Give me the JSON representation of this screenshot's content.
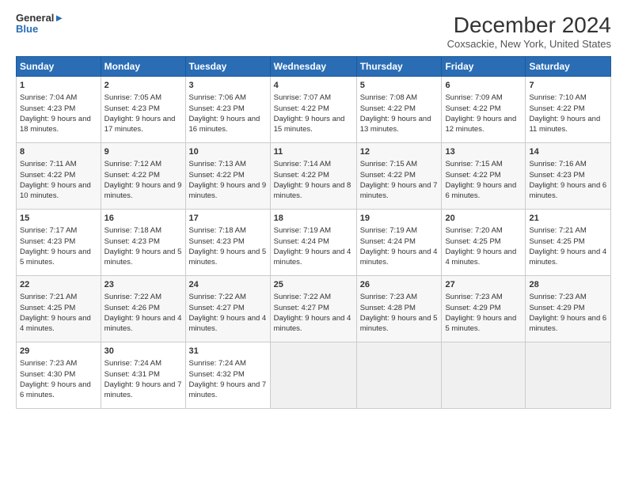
{
  "logo": {
    "line1": "General",
    "line2": "Blue"
  },
  "title": "December 2024",
  "location": "Coxsackie, New York, United States",
  "days_header": [
    "Sunday",
    "Monday",
    "Tuesday",
    "Wednesday",
    "Thursday",
    "Friday",
    "Saturday"
  ],
  "weeks": [
    [
      {
        "day": "1",
        "sunrise": "Sunrise: 7:04 AM",
        "sunset": "Sunset: 4:23 PM",
        "daylight": "Daylight: 9 hours and 18 minutes."
      },
      {
        "day": "2",
        "sunrise": "Sunrise: 7:05 AM",
        "sunset": "Sunset: 4:23 PM",
        "daylight": "Daylight: 9 hours and 17 minutes."
      },
      {
        "day": "3",
        "sunrise": "Sunrise: 7:06 AM",
        "sunset": "Sunset: 4:23 PM",
        "daylight": "Daylight: 9 hours and 16 minutes."
      },
      {
        "day": "4",
        "sunrise": "Sunrise: 7:07 AM",
        "sunset": "Sunset: 4:22 PM",
        "daylight": "Daylight: 9 hours and 15 minutes."
      },
      {
        "day": "5",
        "sunrise": "Sunrise: 7:08 AM",
        "sunset": "Sunset: 4:22 PM",
        "daylight": "Daylight: 9 hours and 13 minutes."
      },
      {
        "day": "6",
        "sunrise": "Sunrise: 7:09 AM",
        "sunset": "Sunset: 4:22 PM",
        "daylight": "Daylight: 9 hours and 12 minutes."
      },
      {
        "day": "7",
        "sunrise": "Sunrise: 7:10 AM",
        "sunset": "Sunset: 4:22 PM",
        "daylight": "Daylight: 9 hours and 11 minutes."
      }
    ],
    [
      {
        "day": "8",
        "sunrise": "Sunrise: 7:11 AM",
        "sunset": "Sunset: 4:22 PM",
        "daylight": "Daylight: 9 hours and 10 minutes."
      },
      {
        "day": "9",
        "sunrise": "Sunrise: 7:12 AM",
        "sunset": "Sunset: 4:22 PM",
        "daylight": "Daylight: 9 hours and 9 minutes."
      },
      {
        "day": "10",
        "sunrise": "Sunrise: 7:13 AM",
        "sunset": "Sunset: 4:22 PM",
        "daylight": "Daylight: 9 hours and 9 minutes."
      },
      {
        "day": "11",
        "sunrise": "Sunrise: 7:14 AM",
        "sunset": "Sunset: 4:22 PM",
        "daylight": "Daylight: 9 hours and 8 minutes."
      },
      {
        "day": "12",
        "sunrise": "Sunrise: 7:15 AM",
        "sunset": "Sunset: 4:22 PM",
        "daylight": "Daylight: 9 hours and 7 minutes."
      },
      {
        "day": "13",
        "sunrise": "Sunrise: 7:15 AM",
        "sunset": "Sunset: 4:22 PM",
        "daylight": "Daylight: 9 hours and 6 minutes."
      },
      {
        "day": "14",
        "sunrise": "Sunrise: 7:16 AM",
        "sunset": "Sunset: 4:23 PM",
        "daylight": "Daylight: 9 hours and 6 minutes."
      }
    ],
    [
      {
        "day": "15",
        "sunrise": "Sunrise: 7:17 AM",
        "sunset": "Sunset: 4:23 PM",
        "daylight": "Daylight: 9 hours and 5 minutes."
      },
      {
        "day": "16",
        "sunrise": "Sunrise: 7:18 AM",
        "sunset": "Sunset: 4:23 PM",
        "daylight": "Daylight: 9 hours and 5 minutes."
      },
      {
        "day": "17",
        "sunrise": "Sunrise: 7:18 AM",
        "sunset": "Sunset: 4:23 PM",
        "daylight": "Daylight: 9 hours and 5 minutes."
      },
      {
        "day": "18",
        "sunrise": "Sunrise: 7:19 AM",
        "sunset": "Sunset: 4:24 PM",
        "daylight": "Daylight: 9 hours and 4 minutes."
      },
      {
        "day": "19",
        "sunrise": "Sunrise: 7:19 AM",
        "sunset": "Sunset: 4:24 PM",
        "daylight": "Daylight: 9 hours and 4 minutes."
      },
      {
        "day": "20",
        "sunrise": "Sunrise: 7:20 AM",
        "sunset": "Sunset: 4:25 PM",
        "daylight": "Daylight: 9 hours and 4 minutes."
      },
      {
        "day": "21",
        "sunrise": "Sunrise: 7:21 AM",
        "sunset": "Sunset: 4:25 PM",
        "daylight": "Daylight: 9 hours and 4 minutes."
      }
    ],
    [
      {
        "day": "22",
        "sunrise": "Sunrise: 7:21 AM",
        "sunset": "Sunset: 4:25 PM",
        "daylight": "Daylight: 9 hours and 4 minutes."
      },
      {
        "day": "23",
        "sunrise": "Sunrise: 7:22 AM",
        "sunset": "Sunset: 4:26 PM",
        "daylight": "Daylight: 9 hours and 4 minutes."
      },
      {
        "day": "24",
        "sunrise": "Sunrise: 7:22 AM",
        "sunset": "Sunset: 4:27 PM",
        "daylight": "Daylight: 9 hours and 4 minutes."
      },
      {
        "day": "25",
        "sunrise": "Sunrise: 7:22 AM",
        "sunset": "Sunset: 4:27 PM",
        "daylight": "Daylight: 9 hours and 4 minutes."
      },
      {
        "day": "26",
        "sunrise": "Sunrise: 7:23 AM",
        "sunset": "Sunset: 4:28 PM",
        "daylight": "Daylight: 9 hours and 5 minutes."
      },
      {
        "day": "27",
        "sunrise": "Sunrise: 7:23 AM",
        "sunset": "Sunset: 4:29 PM",
        "daylight": "Daylight: 9 hours and 5 minutes."
      },
      {
        "day": "28",
        "sunrise": "Sunrise: 7:23 AM",
        "sunset": "Sunset: 4:29 PM",
        "daylight": "Daylight: 9 hours and 6 minutes."
      }
    ],
    [
      {
        "day": "29",
        "sunrise": "Sunrise: 7:23 AM",
        "sunset": "Sunset: 4:30 PM",
        "daylight": "Daylight: 9 hours and 6 minutes."
      },
      {
        "day": "30",
        "sunrise": "Sunrise: 7:24 AM",
        "sunset": "Sunset: 4:31 PM",
        "daylight": "Daylight: 9 hours and 7 minutes."
      },
      {
        "day": "31",
        "sunrise": "Sunrise: 7:24 AM",
        "sunset": "Sunset: 4:32 PM",
        "daylight": "Daylight: 9 hours and 7 minutes."
      },
      null,
      null,
      null,
      null
    ]
  ]
}
